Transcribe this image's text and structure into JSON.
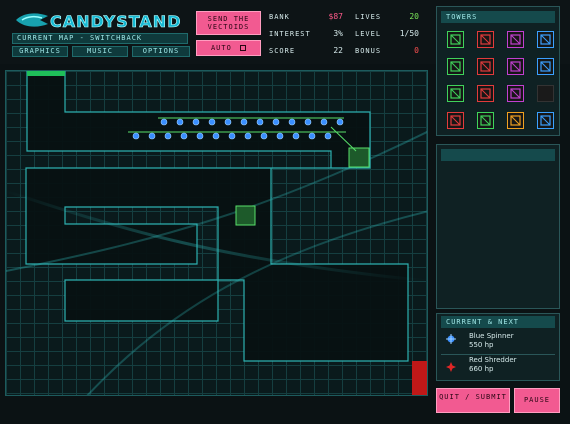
{
  "logo": "CANDYSTAND",
  "current_map": "CURRENT MAP - SWITCHBACK",
  "menu": [
    "GRAPHICS",
    "MUSIC",
    "OPTIONS"
  ],
  "send_button": "SEND THE VECTOIDS",
  "auto_button": "AUTO",
  "stats": {
    "bank_label": "BANK",
    "bank_value": "$87",
    "lives_label": "LIVES",
    "lives_value": "20",
    "interest_label": "INTEREST",
    "interest_value": "3%",
    "level_label": "LEVEL",
    "level_value": "1/50",
    "score_label": "SCORE",
    "score_value": "22",
    "bonus_label": "BONUS",
    "bonus_value": "0"
  },
  "towers_title": "TOWERS",
  "tower_icons": [
    "green-pellet-tower-icon",
    "red-squirt-tower-icon",
    "purple-dart-tower-icon",
    "blue-swirl-tower-icon",
    "green-pellet-tower-2-icon",
    "red-squirt-tower-2-icon",
    "purple-dart-tower-2-icon",
    "blue-swirl-tower-2-icon",
    "green-laser-tower-icon",
    "red-flame-tower-icon",
    "purple-beam-tower-icon",
    "locked-tower-icon",
    "red-bash-tower-icon",
    "green-spread-tower-icon",
    "orange-star-tower-icon",
    "blue-frost-tower-icon"
  ],
  "current_next": {
    "title": "CURRENT & NEXT",
    "current": {
      "name": "Blue Spinner",
      "hp": "550 hp",
      "icon": "blue-spinner-icon"
    },
    "next": {
      "name": "Red Shredder",
      "hp": "660 hp",
      "icon": "red-shredder-icon"
    }
  },
  "quit_button": "QUIT / SUBMIT",
  "pause_button": "PAUSE",
  "colors": {
    "accent_pink": "#f25a91",
    "bank_pink": "#ff5a8a",
    "lives_green": "#7be85a",
    "bonus_red": "#ff5050",
    "path_border": "#2fb7b7"
  }
}
